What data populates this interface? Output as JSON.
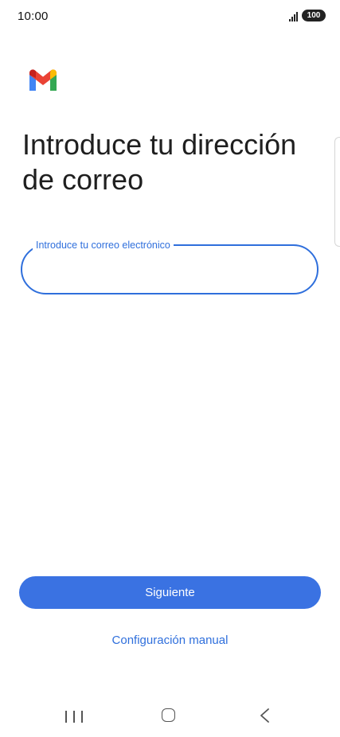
{
  "status_bar": {
    "time": "10:00",
    "battery": "100",
    "signal_icon": "signal-bars-icon"
  },
  "app": {
    "logo_icon": "gmail-logo-icon",
    "colors": {
      "blue": "#4285F4",
      "red": "#EA4335",
      "yellow": "#FBBC04",
      "green": "#34A853",
      "accent": "#2f6fdc",
      "button": "#3a72e2"
    }
  },
  "main": {
    "title": "Introduce tu dirección de correo",
    "email_field": {
      "label": "Introduce tu correo electrónico",
      "value": ""
    },
    "next_button_label": "Siguiente",
    "manual_config_label": "Configuración manual"
  },
  "nav_bar": {
    "recent_icon": "recent-apps-icon",
    "home_icon": "home-icon",
    "back_icon": "back-icon"
  }
}
